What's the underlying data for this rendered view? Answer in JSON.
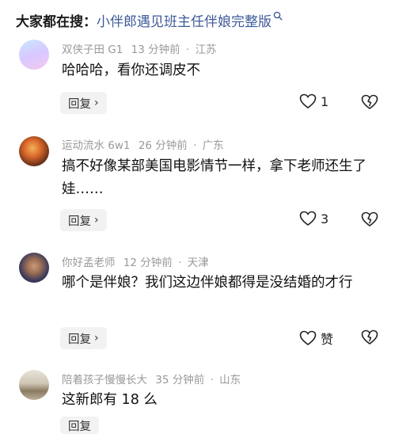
{
  "search": {
    "prefix": "大家都在搜：",
    "query": "小伴郎遇见班主任伴娘完整版"
  },
  "comments": [
    {
      "username": "双侠子田 G1",
      "time": "13 分钟前",
      "location": "江苏",
      "text": "哈哈哈，看你还调皮不",
      "reply_label": "回复",
      "likes": "1"
    },
    {
      "username": "运动流水 6w1",
      "time": "26 分钟前",
      "location": "广东",
      "text": "搞不好像某部美国电影情节一样，拿下老师还生了娃……",
      "reply_label": "回复",
      "likes": "3"
    },
    {
      "username": "你好孟老师",
      "time": "12 分钟前",
      "location": "天津",
      "text": "哪个是伴娘？我们这边伴娘都得是没结婚的才行",
      "reply_label": "回复",
      "likes": "赞"
    },
    {
      "username": "陪着孩子慢慢长大",
      "time": "35 分钟前",
      "location": "山东",
      "text": "这新郎有 18 么",
      "reply_label": "回复"
    }
  ],
  "separator": "·",
  "icons": {
    "search": "search-icon",
    "reply_arrow": "chevron-right-icon",
    "like": "heart-icon",
    "dislike": "broken-heart-icon"
  }
}
